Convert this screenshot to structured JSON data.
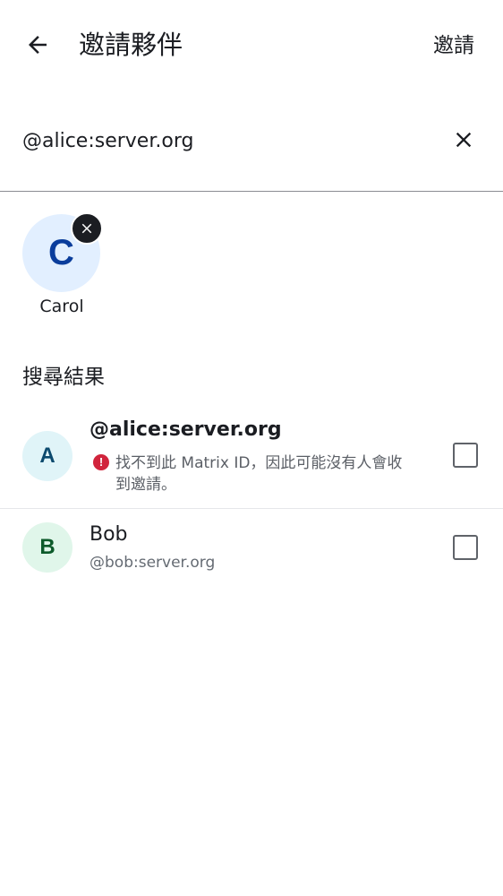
{
  "header": {
    "back_icon": "arrow-left-icon",
    "title": "邀請夥伴",
    "action_label": "邀請"
  },
  "search": {
    "value": "@alice:server.org",
    "clear_icon": "close-icon"
  },
  "selected": [
    {
      "initial": "C",
      "name": "Carol",
      "remove_icon": "close-icon"
    }
  ],
  "results": {
    "header": "搜尋結果",
    "items": [
      {
        "initial": "A",
        "primary": "@alice:server.org",
        "warning_icon": "error-icon",
        "warning_glyph": "!",
        "warning": "找不到此 Matrix ID，因此可能沒有人會收到邀請。",
        "checked": false
      },
      {
        "initial": "B",
        "primary": "Bob",
        "secondary": "@bob:server.org",
        "checked": false
      }
    ]
  },
  "colors": {
    "text": "#1b1d22",
    "warning": "#d1243c",
    "avatar_c_bg": "#e2efff",
    "avatar_a_bg": "#e0f4f8",
    "avatar_b_bg": "#e0f6ea"
  }
}
